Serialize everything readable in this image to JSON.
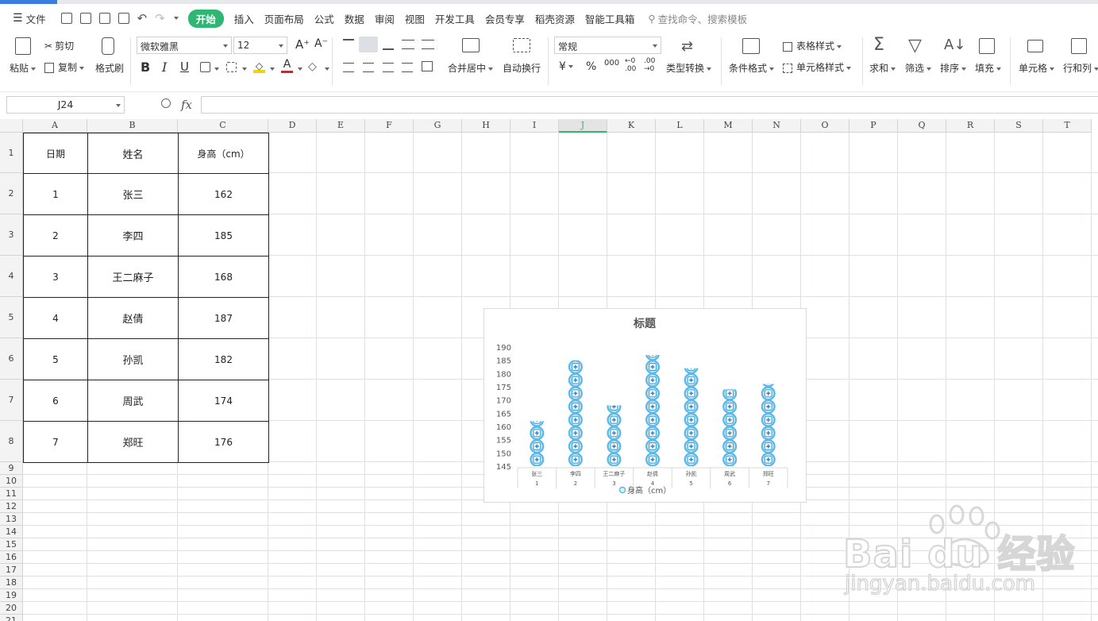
{
  "menu": {
    "file": "文件",
    "tabs": [
      "开始",
      "插入",
      "页面布局",
      "公式",
      "数据",
      "审阅",
      "视图",
      "开发工具",
      "会员专享",
      "稻壳资源",
      "智能工具箱"
    ],
    "active_tab": "开始",
    "search_placeholder": "查找命令、搜索模板"
  },
  "ribbon": {
    "paste": "粘贴",
    "cut": "剪切",
    "copy": "复制",
    "format_painter": "格式刷",
    "font_name": "微软雅黑",
    "font_size": "12",
    "font_grow": "A⁺",
    "font_shrink": "A⁻",
    "bold": "B",
    "italic": "I",
    "underline": "U",
    "merge_center": "合并居中",
    "wrap_text": "自动换行",
    "number_format": "常规",
    "currency": "¥",
    "percent": "%",
    "thousands": "000",
    "dec_increase": "←0\n.00",
    "dec_decrease": ".00\n→0",
    "type_convert": "类型转换",
    "conditional_format": "条件格式",
    "table_style": "表格样式",
    "cell_style": "单元格样式",
    "sum": "求和",
    "filter": "筛选",
    "sort": "排序",
    "fill": "填充",
    "cell": "单元格",
    "row_col": "行和列"
  },
  "formula_bar": {
    "name_box": "J24",
    "fx": "fx",
    "formula": ""
  },
  "sheet": {
    "columns": [
      "A",
      "B",
      "C",
      "D",
      "E",
      "F",
      "G",
      "H",
      "I",
      "J",
      "K",
      "L",
      "M",
      "N",
      "O",
      "P",
      "Q",
      "R",
      "S",
      "T"
    ],
    "selected_column": "J",
    "rows": [
      "1",
      "2",
      "3",
      "4",
      "5",
      "6",
      "7",
      "8",
      "9",
      "10",
      "11",
      "12",
      "13",
      "14",
      "15",
      "16",
      "17",
      "18",
      "19",
      "20",
      "21"
    ],
    "table_header": [
      "日期",
      "姓名",
      "身高（cm）"
    ],
    "table_rows": [
      [
        "1",
        "张三",
        "162"
      ],
      [
        "2",
        "李四",
        "185"
      ],
      [
        "3",
        "王二麻子",
        "168"
      ],
      [
        "4",
        "赵倩",
        "187"
      ],
      [
        "5",
        "孙凯",
        "182"
      ],
      [
        "6",
        "周武",
        "174"
      ],
      [
        "7",
        "郑旺",
        "176"
      ]
    ]
  },
  "chart_data": {
    "type": "bar",
    "title": "标题",
    "categories": [
      "张三",
      "李四",
      "王二麻子",
      "赵倩",
      "孙凯",
      "周武",
      "郑旺"
    ],
    "sub_categories": [
      "1",
      "2",
      "3",
      "4",
      "5",
      "6",
      "7"
    ],
    "series": [
      {
        "name": "身高（cm）",
        "values": [
          162,
          185,
          168,
          187,
          182,
          174,
          176
        ]
      }
    ],
    "ylim": [
      145,
      190
    ],
    "yticks": [
      "190",
      "185",
      "180",
      "175",
      "170",
      "165",
      "160",
      "155",
      "150",
      "145"
    ],
    "legend": "bottom",
    "marker": "picture-stacked-icon",
    "color": "#5bb8e8"
  },
  "watermark": {
    "brand": "Bai du 经验",
    "url": "jingyan.baidu.com"
  },
  "colors": {
    "accent": "#2fb673",
    "grid": "#dde0e6",
    "icon_blue": "#5bb8e8"
  }
}
